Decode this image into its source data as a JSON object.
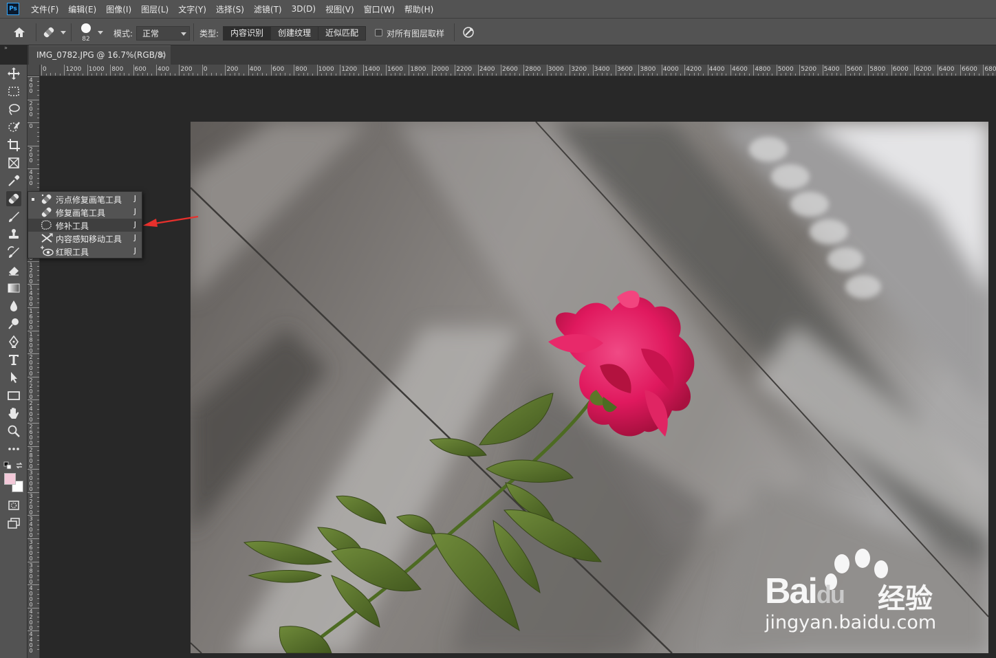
{
  "app": {
    "logo_text": "Ps"
  },
  "menu": [
    "文件(F)",
    "编辑(E)",
    "图像(I)",
    "图层(L)",
    "文字(Y)",
    "选择(S)",
    "滤镜(T)",
    "3D(D)",
    "视图(V)",
    "窗口(W)",
    "帮助(H)"
  ],
  "options": {
    "brush_size": "82",
    "mode_label": "模式:",
    "mode_value": "正常",
    "type_label": "类型:",
    "type_buttons": [
      "内容识别",
      "创建纹理",
      "近似匹配"
    ],
    "sample_all_layers": "对所有图层取样"
  },
  "document": {
    "tab_title": "IMG_0782.JPG @ 16.7%(RGB/8)",
    "close": "×"
  },
  "ruler": {
    "h_labels": [
      "0",
      "1200",
      "1000",
      "800",
      "600",
      "400",
      "200",
      "0",
      "200",
      "400",
      "600",
      "800",
      "1000",
      "1200",
      "1400",
      "1600",
      "1800",
      "2000",
      "2200",
      "2400",
      "2600",
      "2800",
      "3000",
      "3200",
      "3400",
      "3600",
      "3800",
      "4000",
      "4200",
      "4400",
      "4600",
      "4800",
      "5000",
      "5200",
      "5400",
      "5600",
      "5800",
      "6000",
      "6200",
      "6400",
      "6600",
      "6800"
    ],
    "v_labels": [
      "400",
      "200",
      "0",
      "200",
      "400",
      "600",
      "800",
      "1000",
      "1200",
      "1400",
      "1600",
      "1800",
      "2000",
      "2200",
      "2400",
      "2600",
      "2800",
      "3000",
      "3200",
      "3400",
      "3600",
      "3800",
      "4000",
      "4200",
      "4400"
    ]
  },
  "colors": {
    "foreground": "#f3c9d9",
    "background": "#ffffff",
    "annotation_arrow": "#e8302c"
  },
  "flyout": {
    "items": [
      {
        "label": "污点修复画笔工具",
        "key": "J",
        "icon": "spot-healing-brush-icon",
        "current": true
      },
      {
        "label": "修复画笔工具",
        "key": "J",
        "icon": "healing-brush-icon",
        "current": false
      },
      {
        "label": "修补工具",
        "key": "J",
        "icon": "patch-icon",
        "current": false,
        "hovered": true
      },
      {
        "label": "内容感知移动工具",
        "key": "J",
        "icon": "content-aware-move-icon",
        "current": false
      },
      {
        "label": "红眼工具",
        "key": "J",
        "icon": "red-eye-icon",
        "current": false
      }
    ]
  },
  "tools": [
    "move-icon",
    "marquee-icon",
    "lasso-icon",
    "quick-select-icon",
    "crop-icon",
    "frame-icon",
    "eyedropper-icon",
    "healing-brush-icon",
    "brush-icon",
    "stamp-icon",
    "history-brush-icon",
    "eraser-icon",
    "gradient-icon",
    "blur-icon",
    "dodge-icon",
    "pen-icon",
    "type-icon",
    "path-select-icon",
    "rectangle-icon",
    "hand-icon",
    "zoom-icon",
    "more-icon"
  ],
  "watermark": {
    "brand_latin": "Bai",
    "brand_du": "du",
    "brand_cn": "经验",
    "url": "jingyan.baidu.com"
  }
}
